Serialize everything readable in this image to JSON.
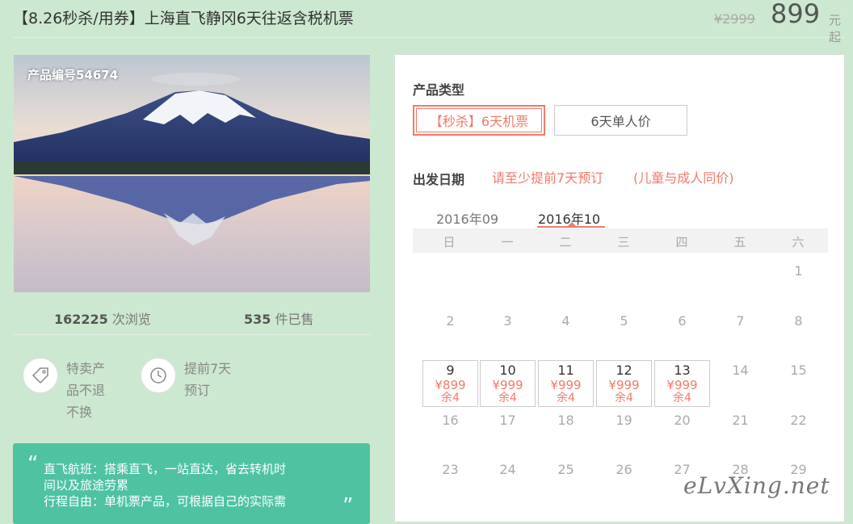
{
  "header": {
    "title": "【8.26秒杀/用券】上海直飞静冈6天往返含税机票",
    "old_price": "¥2999",
    "price": "899",
    "price_suffix": "元起"
  },
  "photo": {
    "product_no": "产品编号54674"
  },
  "stats": {
    "views_num": "162225",
    "views_label": "次浏览",
    "sold_num": "535",
    "sold_label": "件已售"
  },
  "features": [
    {
      "icon": "tag-icon",
      "line1": "特卖产",
      "line2": "品不退",
      "line3": "不换"
    },
    {
      "icon": "clock-icon",
      "line1": "提前7天",
      "line2": "预订"
    }
  ],
  "quote": {
    "open": "“",
    "close": "”",
    "line1": "直飞航班：搭乘直飞，一站直达，省去转机时",
    "line2": "间以及旅途劳累",
    "line3": "行程自由：单机票产品，可根据自己的实际需"
  },
  "booking": {
    "type_label": "产品类型",
    "type_options": [
      "【秒杀】6天机票",
      "6天单人价"
    ],
    "date_label": "出发日期",
    "date_hint1": "请至少提前7天预订",
    "date_hint2": "(儿童与成人同价)",
    "months": [
      "2016年09",
      "2016年10"
    ],
    "weekdays": [
      "日",
      "一",
      "二",
      "三",
      "四",
      "五",
      "六"
    ],
    "row1": [
      "1"
    ],
    "row2": [
      "2",
      "3",
      "4",
      "5",
      "6",
      "7",
      "8"
    ],
    "available": [
      {
        "day": "9",
        "price": "¥899",
        "remain": "余4"
      },
      {
        "day": "10",
        "price": "¥999",
        "remain": "余4"
      },
      {
        "day": "11",
        "price": "¥999",
        "remain": "余4"
      },
      {
        "day": "12",
        "price": "¥999",
        "remain": "余4"
      },
      {
        "day": "13",
        "price": "¥999",
        "remain": "余4"
      }
    ],
    "row3_rest": [
      "14",
      "15"
    ],
    "row4": [
      "16",
      "17",
      "18",
      "19",
      "20",
      "21",
      "22"
    ],
    "row5": [
      "23",
      "24",
      "25",
      "26",
      "27",
      "28",
      "29"
    ]
  },
  "watermark": "eLvXing.net",
  "colors": {
    "accent": "#f07a6a",
    "page_bg": "#cde8d0",
    "quote_bg": "#4fc3a1"
  }
}
